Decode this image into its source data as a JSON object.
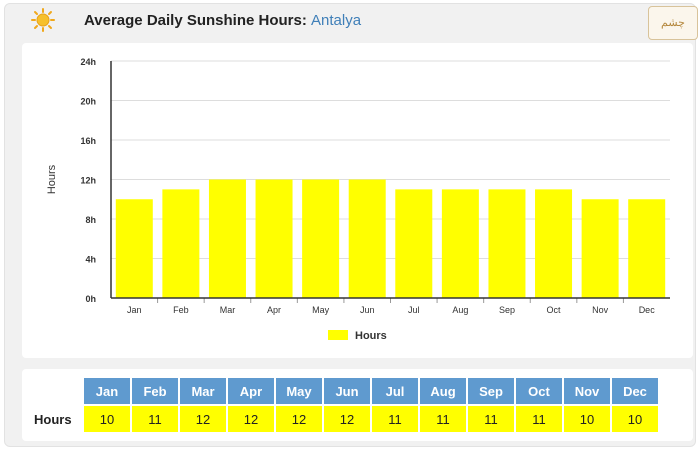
{
  "header": {
    "title": "Average Daily Sunshine Hours:",
    "location": "Antalya",
    "logo_text": "چشم"
  },
  "chart_data": {
    "type": "bar",
    "title": "",
    "xlabel": "",
    "ylabel": "Hours",
    "ylim": [
      0,
      24
    ],
    "yticks": [
      "0h",
      "4h",
      "8h",
      "12h",
      "16h",
      "20h",
      "24h"
    ],
    "categories": [
      "Jan",
      "Feb",
      "Mar",
      "Apr",
      "May",
      "Jun",
      "Jul",
      "Aug",
      "Sep",
      "Oct",
      "Nov",
      "Dec"
    ],
    "series": [
      {
        "name": "Hours",
        "values": [
          10,
          11,
          12,
          12,
          12,
          12,
          11,
          11,
          11,
          11,
          10,
          10
        ]
      }
    ],
    "legend_position": "bottom",
    "bar_color": "#ffff00",
    "grid": true
  },
  "table": {
    "row_label": "Hours",
    "months": [
      "Jan",
      "Feb",
      "Mar",
      "Apr",
      "May",
      "Jun",
      "Jul",
      "Aug",
      "Sep",
      "Oct",
      "Nov",
      "Dec"
    ],
    "values": [
      "10",
      "11",
      "12",
      "12",
      "12",
      "12",
      "11",
      "11",
      "11",
      "11",
      "10",
      "10"
    ]
  },
  "colors": {
    "header_cell": "#5f9acf",
    "value_cell": "#ffff00",
    "location": "#3f7fb8"
  }
}
